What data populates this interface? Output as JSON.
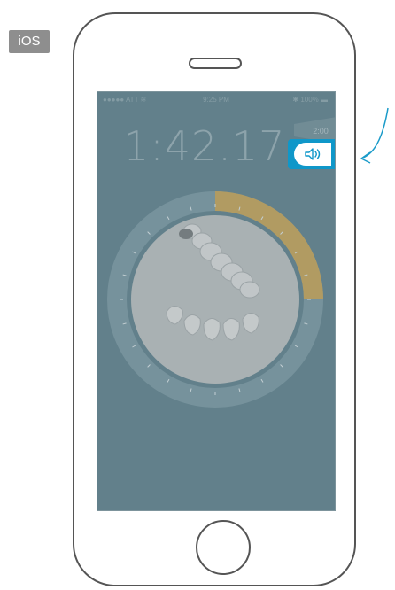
{
  "platform": {
    "label": "iOS"
  },
  "status_bar": {
    "carrier": "●●●●● ATT ≋",
    "time": "9:25 PM",
    "battery": "✱ 100% ▬"
  },
  "timer": {
    "value": "1:42.17",
    "remaining_badge": "2:00"
  },
  "sound_button": {
    "icon": "speaker-icon"
  },
  "progress": {
    "elapsed_fraction": 0.25
  },
  "colors": {
    "screen_bg": "#62808b",
    "progress_fill": "#b89c5c",
    "accent": "#0f97c9",
    "ring": "#7e98a2"
  }
}
